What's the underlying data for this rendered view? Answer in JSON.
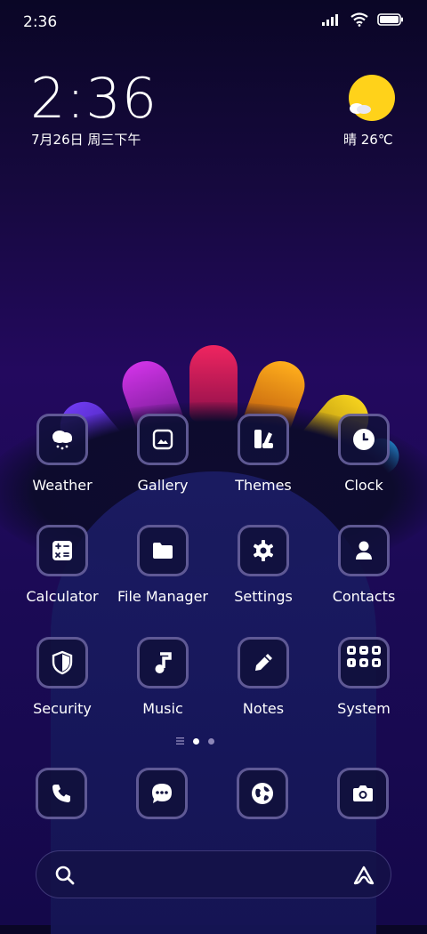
{
  "status_bar": {
    "time": "2:36",
    "icons": [
      "signal-icon",
      "wifi-icon",
      "battery-icon"
    ]
  },
  "clock_widget": {
    "time": "2:36",
    "date": "7月26日 周三下午"
  },
  "weather_widget": {
    "condition_temp": "晴 26℃",
    "icon": "sunny-icon"
  },
  "apps": [
    {
      "label": "Weather",
      "icon": "cloud-snow-icon"
    },
    {
      "label": "Gallery",
      "icon": "image-icon"
    },
    {
      "label": "Themes",
      "icon": "themes-icon"
    },
    {
      "label": "Clock",
      "icon": "clock-icon"
    },
    {
      "label": "Calculator",
      "icon": "calculator-icon"
    },
    {
      "label": "File Manager",
      "icon": "folder-icon"
    },
    {
      "label": "Settings",
      "icon": "gear-icon"
    },
    {
      "label": "Contacts",
      "icon": "person-icon"
    },
    {
      "label": "Security",
      "icon": "shield-icon"
    },
    {
      "label": "Music",
      "icon": "music-note-icon"
    },
    {
      "label": "Notes",
      "icon": "pencil-icon"
    },
    {
      "label": "System",
      "icon": "folder-grid-icon"
    }
  ],
  "page_indicator": {
    "pages": 2,
    "current": 1
  },
  "dock": [
    "phone-icon",
    "messages-icon",
    "browser-icon",
    "camera-icon"
  ],
  "search_bar": {
    "left_icon": "search-icon",
    "right_icon": "assistant-icon"
  },
  "colors": {
    "petals": [
      "#5a2bd6",
      "#c02ad4",
      "#e3205e",
      "#f3a11c",
      "#e8c21a",
      "#1e8fe0"
    ],
    "sun": "#ffd21a"
  }
}
